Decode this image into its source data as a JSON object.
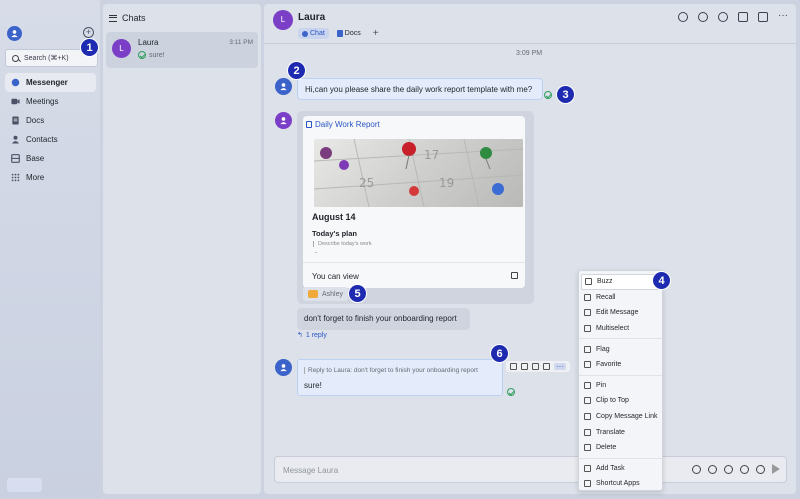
{
  "sidebar": {
    "search_label": "Search (⌘+K)",
    "items": [
      {
        "label": "Messenger",
        "icon": "chat-bubble-icon"
      },
      {
        "label": "Meetings",
        "icon": "video-icon"
      },
      {
        "label": "Docs",
        "icon": "doc-icon"
      },
      {
        "label": "Contacts",
        "icon": "person-icon"
      },
      {
        "label": "Base",
        "icon": "base-icon"
      },
      {
        "label": "More",
        "icon": "grid-icon"
      }
    ]
  },
  "chatlist": {
    "title": "Chats",
    "items": [
      {
        "avatar": "L",
        "name": "Laura",
        "time": "3:11 PM",
        "preview": "sure!"
      }
    ]
  },
  "conversation": {
    "avatar": "L",
    "title": "Laura",
    "tabs": [
      {
        "label": "Chat"
      },
      {
        "label": "Docs"
      }
    ],
    "timestamp": "3:09 PM",
    "message1": "Hi,can you please share the daily work report template with me?",
    "card": {
      "title": "Daily Work Report",
      "date": "August 14",
      "section": "Today's plan",
      "placeholder": "Describe today's work",
      "dash": "-",
      "footer": "You can view"
    },
    "reaction_name": "Ashley",
    "message2": "don't forget to finish your onboarding report",
    "reply_count": "1 reply",
    "quote": "Reply to Laura:  don't forget to finish your onboarding report",
    "reply_text": "sure!",
    "input_placeholder": "Message Laura"
  },
  "context_menu": {
    "groups": [
      [
        "Buzz",
        "Recall",
        "Edit Message",
        "Multiselect"
      ],
      [
        "Flag",
        "Favorite"
      ],
      [
        "Pin",
        "Clip to Top",
        "Copy Message Link",
        "Translate",
        "Delete"
      ],
      [
        "Add Task",
        "Shortcut Apps"
      ]
    ]
  },
  "markers": [
    "1",
    "2",
    "3",
    "4",
    "5",
    "6"
  ],
  "colors": {
    "accent": "#3b63c9",
    "laura_avatar": "#7b3fc7",
    "marker": "#1e2bb0",
    "read_tick": "#2f9e5e"
  }
}
